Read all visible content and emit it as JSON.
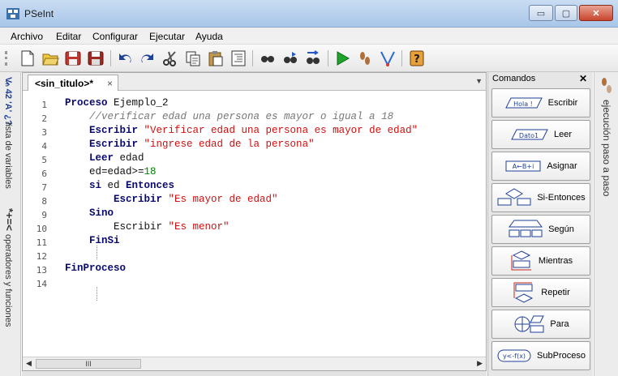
{
  "window": {
    "title": "PSeInt",
    "minimize": "▭",
    "maximize": "▢",
    "close": "✕"
  },
  "menu": [
    "Archivo",
    "Editar",
    "Configurar",
    "Ejecutar",
    "Ayuda"
  ],
  "toolbar_icons": [
    "new-file-icon",
    "open-folder-icon",
    "save-icon",
    "save-as-icon",
    "undo-icon",
    "redo-icon",
    "cut-icon",
    "copy-icon",
    "paste-icon",
    "indent-icon",
    "search-icon",
    "find-next-icon",
    "replace-icon",
    "run-icon",
    "step-icon",
    "flowchart-icon",
    "help-icon"
  ],
  "left_panel": {
    "vars_label": "lista de variables",
    "vars_icon": "V̷ₙ 42 'A' ¿?",
    "ops_icon": "*+=<",
    "ops_label": "operadores y funciones"
  },
  "editor": {
    "tab_label": "<sin_titulo>*",
    "tab_close": "×",
    "line_numbers": [
      "1",
      "2",
      "3",
      "4",
      "5",
      "6",
      "7",
      "8",
      "9",
      "10",
      "11",
      "12",
      "13",
      "14"
    ],
    "lines": [
      [
        {
          "t": "kw",
          "v": "Proceso"
        },
        {
          "t": "tx",
          "v": " Ejemplo_2"
        }
      ],
      [
        {
          "t": "cm",
          "v": "    //verificar edad una persona es mayor o igual a 18"
        }
      ],
      [
        {
          "t": "kw",
          "v": "    Escribir "
        },
        {
          "t": "st",
          "v": "\"Verificar edad una persona es mayor de edad\""
        }
      ],
      [
        {
          "t": "kw",
          "v": "    Escribir "
        },
        {
          "t": "st",
          "v": "\"ingrese edad de la persona\""
        }
      ],
      [
        {
          "t": "kw",
          "v": "    Leer"
        },
        {
          "t": "tx",
          "v": " edad"
        }
      ],
      [
        {
          "t": "tx",
          "v": "    ed=edad>="
        },
        {
          "t": "nm",
          "v": "18"
        }
      ],
      [
        {
          "t": "kw",
          "v": "    si"
        },
        {
          "t": "tx",
          "v": " ed "
        },
        {
          "t": "kw",
          "v": "Entonces"
        }
      ],
      [
        {
          "t": "kw",
          "v": "        Escribir "
        },
        {
          "t": "st",
          "v": "\"Es mayor de edad\""
        }
      ],
      [
        {
          "t": "kw",
          "v": "    Sino"
        }
      ],
      [
        {
          "t": "tx",
          "v": "        Escribir "
        },
        {
          "t": "st",
          "v": "\"Es menor\""
        }
      ],
      [
        {
          "t": "kw",
          "v": "    FinSi"
        }
      ],
      [],
      [
        {
          "t": "kw",
          "v": "FinProceso"
        }
      ],
      []
    ],
    "scroll_thumb": "III"
  },
  "commands": {
    "title": "Comandos",
    "close": "✕",
    "items": [
      {
        "label": "Escribir",
        "icon_text": "Hola !"
      },
      {
        "label": "Leer",
        "icon_text": "Dato1"
      },
      {
        "label": "Asignar",
        "icon_text": "A←B+i"
      },
      {
        "label": "Si-Entonces",
        "icon_text": ""
      },
      {
        "label": "Según",
        "icon_text": ""
      },
      {
        "label": "Mientras",
        "icon_text": ""
      },
      {
        "label": "Repetir",
        "icon_text": ""
      },
      {
        "label": "Para",
        "icon_text": ""
      },
      {
        "label": "SubProceso",
        "icon_text": "y<-f(x)"
      }
    ]
  },
  "right_strip": {
    "label": "ejecución paso a paso"
  }
}
